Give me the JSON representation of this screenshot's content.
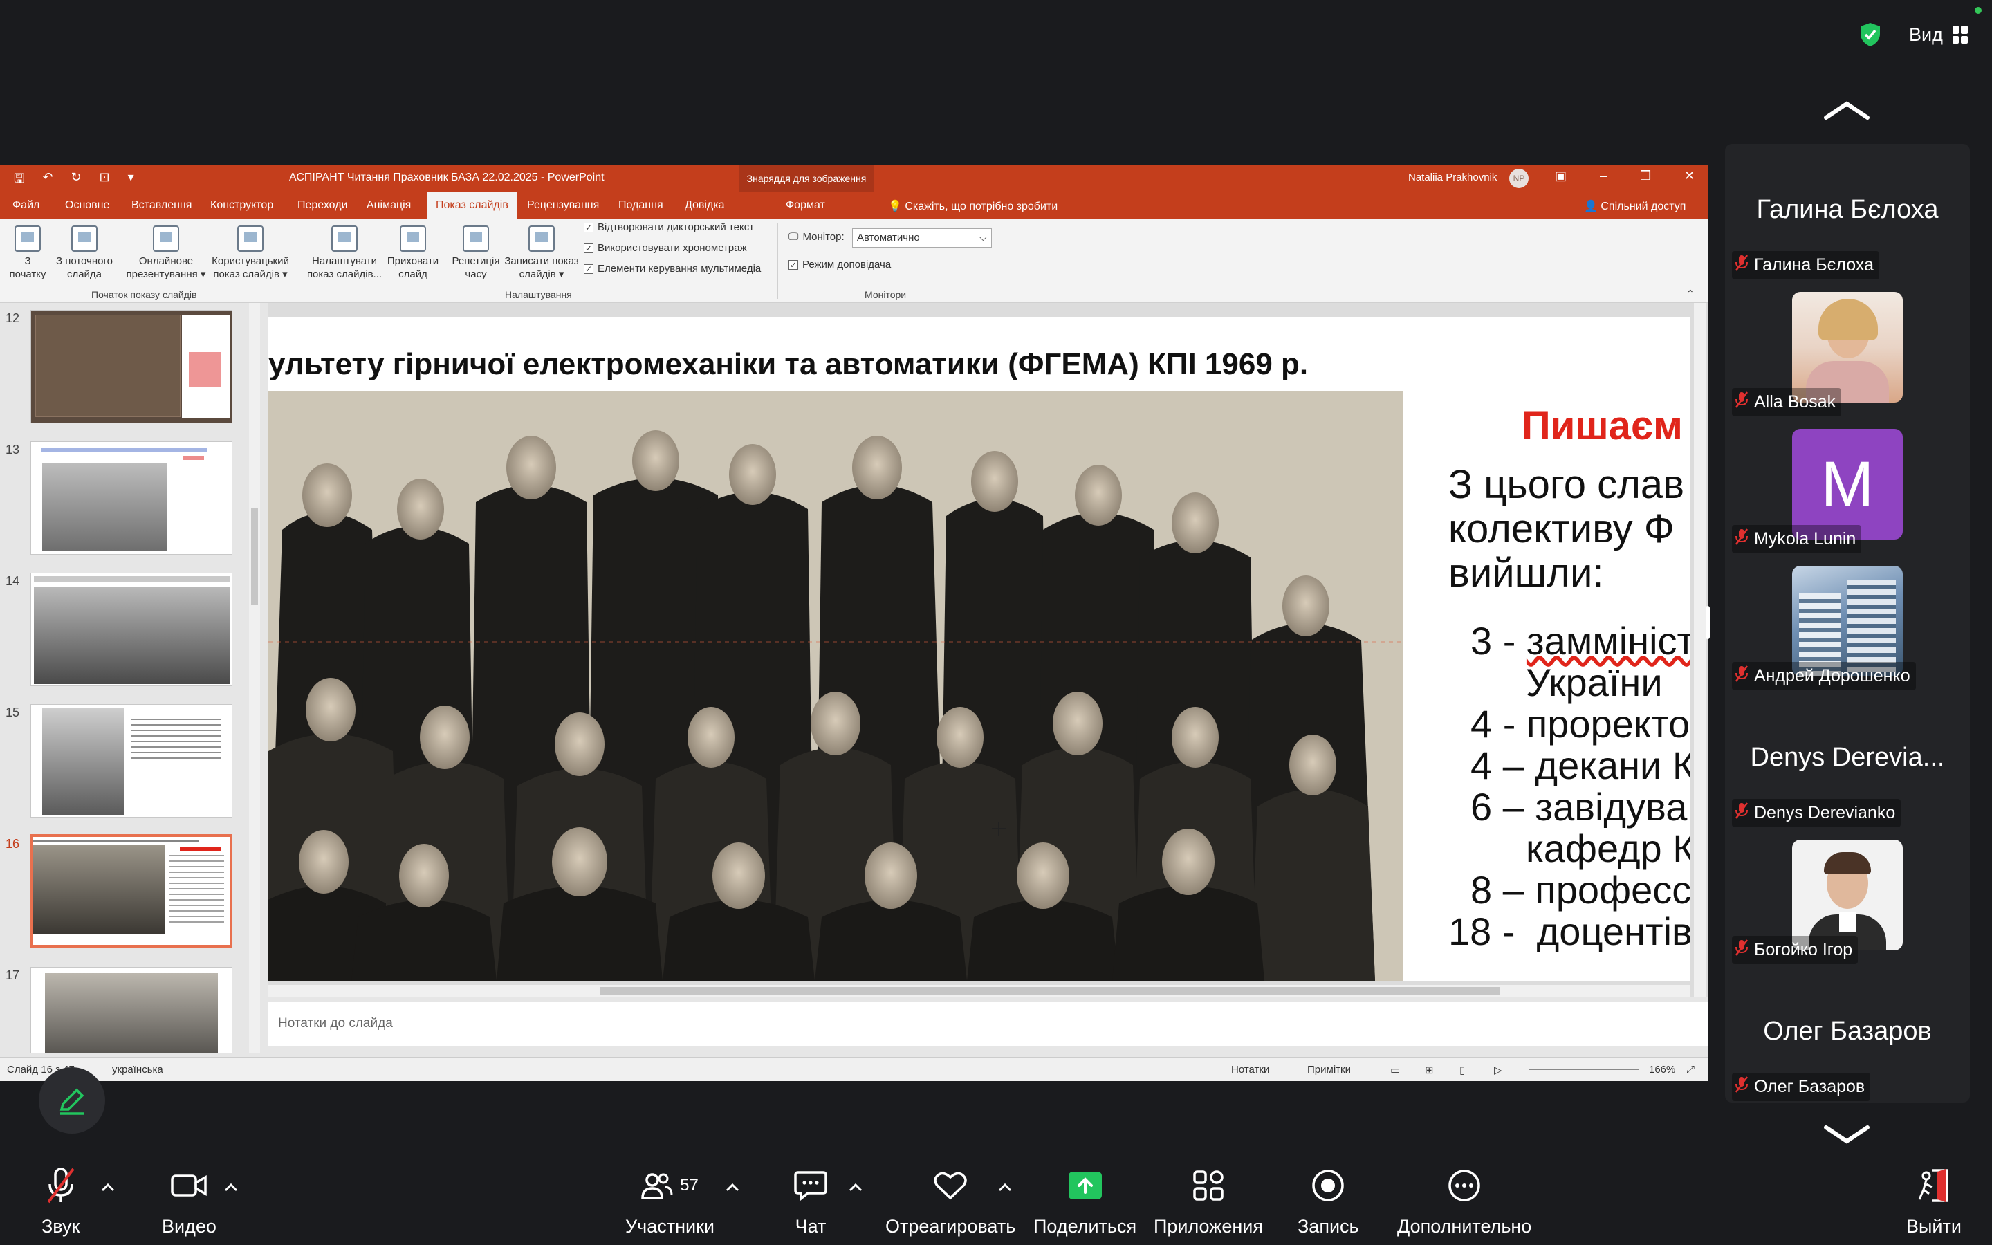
{
  "topbar": {
    "view_label": "Вид"
  },
  "ppt": {
    "doc_title": "АСПІРАНТ Читання Праховник БАЗА 22.02.2025  -  PowerPoint",
    "tools_context": "Знаряддя для зображення",
    "user_name": "Nataliia Prakhovnik",
    "user_initials": "NP",
    "tabs": [
      "Файл",
      "Основне",
      "Вставлення",
      "Конструктор",
      "Переходи",
      "Анімація",
      "Показ слайдів",
      "Рецензування",
      "Подання",
      "Довідка",
      "Формат"
    ],
    "tell_me": "Скажіть, що потрібно зробити",
    "share": "Спільний доступ",
    "ribbon": {
      "btn_from_start_1": "З",
      "btn_from_start_2": "початку",
      "btn_from_current_1": "З поточного",
      "btn_from_current_2": "слайда",
      "btn_online_1": "Онлайнове",
      "btn_online_2": "презентування ▾",
      "btn_custom_1": "Користувацький",
      "btn_custom_2": "показ слайдів ▾",
      "group_start": "Початок показу слайдів",
      "btn_setup_1": "Налаштувати",
      "btn_setup_2": "показ слайдів...",
      "btn_hide_1": "Приховати",
      "btn_hide_2": "слайд",
      "btn_rehearse_1": "Репетиція",
      "btn_rehearse_2": "часу",
      "btn_record_1": "Записати показ",
      "btn_record_2": "слайдів ▾",
      "check_narration": "Відтворювати дикторський текст",
      "check_timings": "Використовувати хронометраж",
      "check_media": "Елементи керування мультимедіа",
      "group_setup": "Налаштування",
      "monitor_label": "Монітор:",
      "monitor_value": "Автоматично",
      "presenter_view": "Режим доповідача",
      "group_monitors": "Монітори"
    },
    "thumb_numbers": [
      "12",
      "13",
      "14",
      "15",
      "16",
      "17"
    ],
    "slide": {
      "heading": "ультету гірничої електромеханіки та автоматики (ФГЕМА) КПІ  1969 р.",
      "red_title": "Пишаєм",
      "para": [
        "З цього слав",
        "колективу Ф",
        "вийшли:"
      ],
      "list": [
        {
          "num": "3 -",
          "text": "заммініст",
          "cont": "України"
        },
        {
          "num": "4 -",
          "text": "проректо"
        },
        {
          "num": "4 –",
          "text": "декани К"
        },
        {
          "num": "6 –",
          "text": "завідува",
          "cont": "кафедр К"
        },
        {
          "num": "8 –",
          "text": "професс"
        },
        {
          "num": "18 -",
          "text": "доцентів"
        }
      ]
    },
    "notes_placeholder": "Нотатки до слайда",
    "status": {
      "slide": "Слайд 16 з 47",
      "language": "українська",
      "notes": "Нотатки",
      "comments": "Примітки",
      "zoom": "166%"
    }
  },
  "gallery": [
    {
      "big": "Галина Бєлоха",
      "label": "Галина Бєлоха",
      "type": "name"
    },
    {
      "label": "Alla Bosak",
      "type": "photo",
      "colors": [
        "#e9d4c6",
        "#d9a788",
        "#f2e9e1"
      ]
    },
    {
      "label": "Mykola Lunin",
      "type": "initial",
      "initial": "M",
      "color": "#8e44c1"
    },
    {
      "label": "Андрей Дорошенко",
      "type": "photo",
      "colors": [
        "#6f8fb3",
        "#3b5670",
        "#c7d6e6"
      ]
    },
    {
      "big": "Denys Derevia...",
      "label": "Denys Derevianko",
      "type": "name"
    },
    {
      "label": "Богойко Ігор",
      "type": "photo",
      "colors": [
        "#f2f2f2",
        "#d7a98e",
        "#2b2b2b"
      ]
    },
    {
      "big": "Олег Базаров",
      "label": "Олег Базаров",
      "type": "name"
    }
  ],
  "toolbar": {
    "audio": "Звук",
    "video": "Видео",
    "participants": "Участники",
    "participants_count": "57",
    "chat": "Чат",
    "react": "Отреагировать",
    "share": "Поделиться",
    "apps": "Приложения",
    "record": "Запись",
    "more": "Дополнительно",
    "leave": "Выйти"
  },
  "colors": {
    "ppt_accent": "#c43e1c",
    "share_green": "#22c55e",
    "muted_red": "#e0302f",
    "mykola_bg": "#8e44c1"
  }
}
